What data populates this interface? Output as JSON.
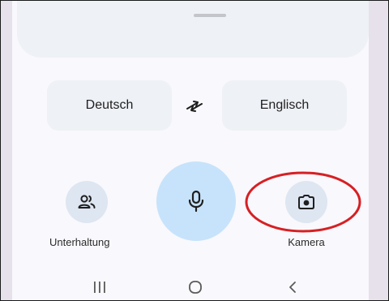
{
  "languages": {
    "source": "Deutsch",
    "target": "Englisch"
  },
  "actions": {
    "conversation_label": "Unterhaltung",
    "camera_label": "Kamera"
  },
  "icons": {
    "swap": "swap-arrows-icon",
    "conversation": "people-icon",
    "microphone": "mic-icon",
    "camera": "camera-icon",
    "recents": "recents-icon",
    "home": "home-icon",
    "back": "back-chevron-icon"
  },
  "colors": {
    "background": "#f9f8fc",
    "side_background": "#e6e1ea",
    "chip": "#eef1f6",
    "mic_accent": "#c7e3fb",
    "icon_button": "#dde6f1",
    "annotation": "#d62024"
  }
}
